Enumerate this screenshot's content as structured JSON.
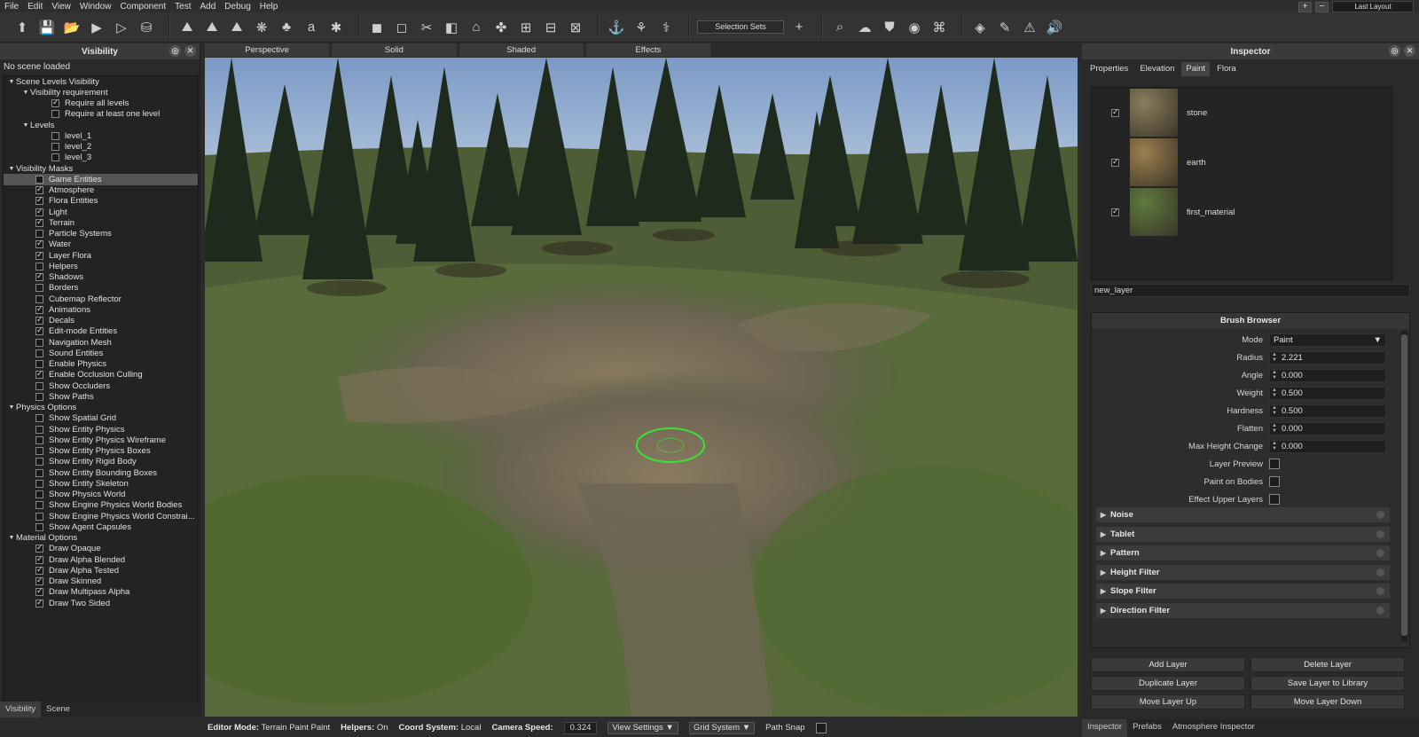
{
  "menu": [
    "File",
    "Edit",
    "View",
    "Window",
    "Component",
    "Test",
    "Add",
    "Debug",
    "Help"
  ],
  "top_right": {
    "plus": "+",
    "minus": "−",
    "layout": "Last Layout"
  },
  "toolbar": {
    "selection_sets": "Selection Sets",
    "add": "+"
  },
  "left_panel": {
    "title": "Visibility",
    "status": "No scene loaded",
    "tree": [
      {
        "label": "Scene Levels Visibility",
        "indent": 0,
        "arrow": true
      },
      {
        "label": "Visibility requirement",
        "indent": 1,
        "arrow": true
      },
      {
        "label": "Require all levels",
        "indent": 2,
        "check": true
      },
      {
        "label": "Require at least one level",
        "indent": 2,
        "check": false
      },
      {
        "label": "Levels",
        "indent": 1,
        "arrow": true
      },
      {
        "label": "level_1",
        "indent": 2,
        "check": false
      },
      {
        "label": "level_2",
        "indent": 2,
        "check": false
      },
      {
        "label": "level_3",
        "indent": 2,
        "check": false
      },
      {
        "label": "Visibility Masks",
        "indent": 0,
        "arrow": true
      },
      {
        "label": "Game Entities",
        "indent": 1,
        "check": false,
        "selected": true
      },
      {
        "label": "Atmosphere",
        "indent": 1,
        "check": true
      },
      {
        "label": "Flora Entities",
        "indent": 1,
        "check": true
      },
      {
        "label": "Light",
        "indent": 1,
        "check": true
      },
      {
        "label": "Terrain",
        "indent": 1,
        "check": true
      },
      {
        "label": "Particle Systems",
        "indent": 1,
        "check": false
      },
      {
        "label": "Water",
        "indent": 1,
        "check": true
      },
      {
        "label": "Layer Flora",
        "indent": 1,
        "check": true
      },
      {
        "label": "Helpers",
        "indent": 1,
        "check": false
      },
      {
        "label": "Shadows",
        "indent": 1,
        "check": true
      },
      {
        "label": "Borders",
        "indent": 1,
        "check": false
      },
      {
        "label": "Cubemap Reflector",
        "indent": 1,
        "check": false
      },
      {
        "label": "Animations",
        "indent": 1,
        "check": true
      },
      {
        "label": "Decals",
        "indent": 1,
        "check": true
      },
      {
        "label": "Edit-mode Entities",
        "indent": 1,
        "check": true
      },
      {
        "label": "Navigation Mesh",
        "indent": 1,
        "check": false
      },
      {
        "label": "Sound Entities",
        "indent": 1,
        "check": false
      },
      {
        "label": "Enable Physics",
        "indent": 1,
        "check": false
      },
      {
        "label": "Enable Occlusion Culling",
        "indent": 1,
        "check": true
      },
      {
        "label": "Show Occluders",
        "indent": 1,
        "check": false
      },
      {
        "label": "Show Paths",
        "indent": 1,
        "check": false
      },
      {
        "label": "Physics Options",
        "indent": 0,
        "arrow": true
      },
      {
        "label": "Show Spatial Grid",
        "indent": 1,
        "check": false
      },
      {
        "label": "Show Entity Physics",
        "indent": 1,
        "check": false
      },
      {
        "label": "Show Entity Physics Wireframe",
        "indent": 1,
        "check": false
      },
      {
        "label": "Show Entity Physics Boxes",
        "indent": 1,
        "check": false
      },
      {
        "label": "Show Entity Rigid Body",
        "indent": 1,
        "check": false
      },
      {
        "label": "Show Entity Bounding Boxes",
        "indent": 1,
        "check": false
      },
      {
        "label": "Show Entity Skeleton",
        "indent": 1,
        "check": false
      },
      {
        "label": "Show Physics World",
        "indent": 1,
        "check": false
      },
      {
        "label": "Show Engine Physics World Bodies",
        "indent": 1,
        "check": false
      },
      {
        "label": "Show Engine Physics World Constrai...",
        "indent": 1,
        "check": false
      },
      {
        "label": "Show Agent Capsules",
        "indent": 1,
        "check": false
      },
      {
        "label": "Material Options",
        "indent": 0,
        "arrow": true
      },
      {
        "label": "Draw Opaque",
        "indent": 1,
        "check": true
      },
      {
        "label": "Draw Alpha Blended",
        "indent": 1,
        "check": true
      },
      {
        "label": "Draw Alpha Tested",
        "indent": 1,
        "check": true
      },
      {
        "label": "Draw Skinned",
        "indent": 1,
        "check": true
      },
      {
        "label": "Draw Multipass Alpha",
        "indent": 1,
        "check": true
      },
      {
        "label": "Draw Two Sided",
        "indent": 1,
        "check": true
      }
    ],
    "tabs": [
      "Visibility",
      "Scene"
    ]
  },
  "viewport_tabs": [
    "Perspective",
    "Solid",
    "Shaded",
    "Effects"
  ],
  "inspector": {
    "title": "Inspector",
    "tabs": [
      "Properties",
      "Elevation",
      "Paint",
      "Flora"
    ],
    "active_tab": "Paint",
    "materials": [
      {
        "name": "stone",
        "checked": true,
        "color": "#8a7c5e"
      },
      {
        "name": "earth",
        "checked": true,
        "color": "#9c7f4f"
      },
      {
        "name": "first_material",
        "checked": true,
        "color": "#5e7a3e"
      }
    ],
    "layer_name": "new_layer",
    "brush": {
      "title": "Brush Browser",
      "mode_label": "Mode",
      "mode": "Paint",
      "numeric": [
        {
          "label": "Radius",
          "value": "2.221"
        },
        {
          "label": "Angle",
          "value": "0.000"
        },
        {
          "label": "Weight",
          "value": "0.500"
        },
        {
          "label": "Hardness",
          "value": "0.500"
        },
        {
          "label": "Flatten",
          "value": "0.000"
        },
        {
          "label": "Max Height Change",
          "value": "0.000"
        }
      ],
      "checks": [
        {
          "label": "Layer Preview"
        },
        {
          "label": "Paint on Bodies"
        },
        {
          "label": "Effect Upper Layers"
        }
      ],
      "sections": [
        "Noise",
        "Tablet",
        "Pattern",
        "Height Filter",
        "Slope Filter",
        "Direction Filter"
      ]
    },
    "actions": [
      "Add Layer",
      "Delete Layer",
      "Duplicate Layer",
      "Save Layer to Library",
      "Move Layer Up",
      "Move Layer Down"
    ],
    "bottom_tabs": [
      "Inspector",
      "Prefabs",
      "Atmosphere Inspector"
    ]
  },
  "status": {
    "editor_mode_label": "Editor Mode:",
    "editor_mode": "Terrain Paint Paint",
    "helpers_label": "Helpers:",
    "helpers": "On",
    "coord_label": "Coord System:",
    "coord": "Local",
    "speed_label": "Camera Speed:",
    "speed": "0.324",
    "view_settings": "View Settings",
    "grid_system": "Grid System",
    "path_snap": "Path Snap"
  }
}
